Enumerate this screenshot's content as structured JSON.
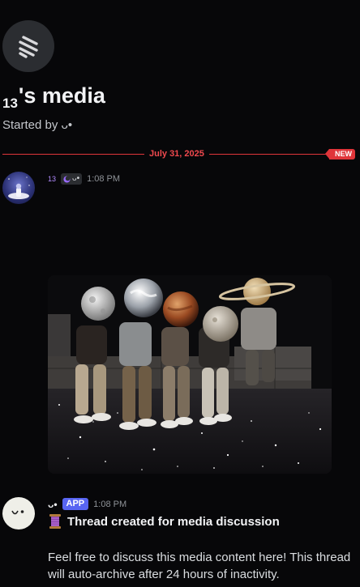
{
  "header": {
    "title_prefix": "13",
    "title_main": "'s media",
    "started_by_label": "Started by",
    "starter_name": "ᴗ•"
  },
  "divider": {
    "date": "July 31, 2025",
    "new_label": "NEW"
  },
  "messages": [
    {
      "author": "13",
      "tag_text": "ᴗ•",
      "timestamp": "1:08 PM",
      "attachment": {
        "type": "image",
        "subject": "people sitting with planet heads against a starry sky"
      }
    },
    {
      "author": "ᴗ•",
      "badge": "APP",
      "timestamp": "1:08 PM",
      "title_icon": "thread-spool-icon",
      "title": "Thread created for media discussion",
      "body": "Feel free to discuss this media content here! This thread will auto-archive after 24 hours of inactivity."
    }
  ],
  "colors": {
    "background": "#070709",
    "divider": "#e0353a",
    "app_badge": "#5865f2",
    "username_accent": "#b28cff"
  }
}
